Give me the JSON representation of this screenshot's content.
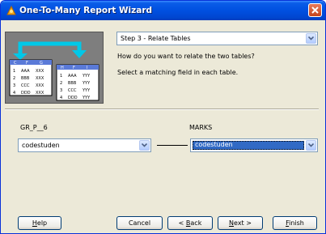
{
  "window": {
    "title": "One-To-Many Report Wizard"
  },
  "step": {
    "selected": "Step 3 - Relate Tables"
  },
  "instructions": {
    "q1": "How do you want to relate the two tables?",
    "q2": "Select a matching field in each table."
  },
  "left_table": {
    "name": "GR_P__6",
    "field": "codestuden"
  },
  "right_table": {
    "name": "MARKS",
    "field": "codestuden"
  },
  "graphic": {
    "left_header": [
      "C",
      "F",
      "G"
    ],
    "left_rows": [
      [
        "1",
        "AAA",
        "XXX"
      ],
      [
        "2",
        "BBB",
        "XXX"
      ],
      [
        "3",
        "CCC",
        "XXX"
      ],
      [
        "4",
        "DDD",
        "XXX"
      ]
    ],
    "right_header": [
      "H",
      "F",
      "I"
    ],
    "right_rows": [
      [
        "1",
        "AAA",
        "YYY"
      ],
      [
        "2",
        "BBB",
        "YYY"
      ],
      [
        "3",
        "CCC",
        "YYY"
      ],
      [
        "4",
        "DDD",
        "YYY"
      ]
    ]
  },
  "buttons": {
    "help": {
      "mnemonic": "H",
      "rest": "elp"
    },
    "cancel": "Cancel",
    "back": {
      "prefix": "< ",
      "mnemonic": "B",
      "rest": "ack"
    },
    "next": {
      "mnemonic": "N",
      "rest": "ext >"
    },
    "finish": {
      "mnemonic": "F",
      "rest": "inish"
    }
  },
  "colors": {
    "titlebar": "#0050e0",
    "selection": "#316ac5",
    "arrow": "#00c8e8"
  }
}
